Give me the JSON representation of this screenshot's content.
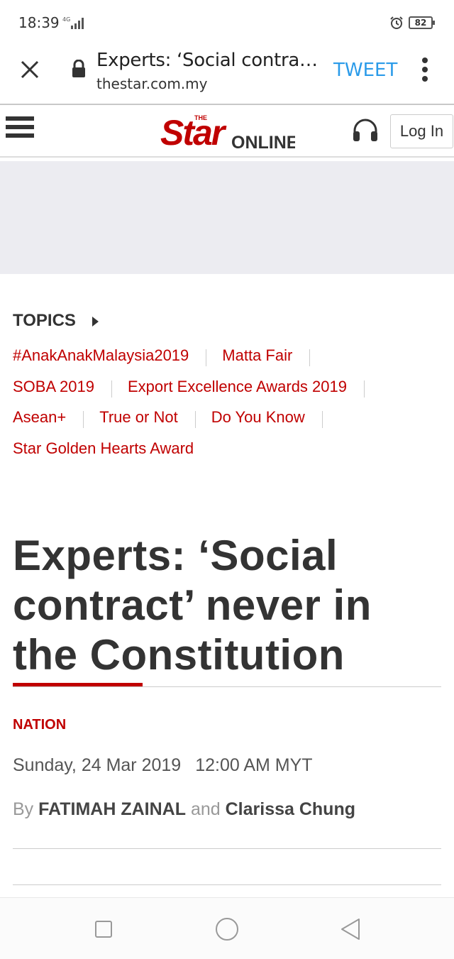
{
  "status_bar": {
    "time": "18:39",
    "network": "4G",
    "battery": "82"
  },
  "browser": {
    "title": "Experts: ‘Social contra…",
    "url": "thestar.com.my",
    "tweet_label": "TWEET"
  },
  "site_header": {
    "logo_the": "THE",
    "logo_star": "Star",
    "logo_online": "ONLINE",
    "login_label": "Log In"
  },
  "topics": {
    "heading": "TOPICS",
    "rows": [
      [
        "#AnakAnakMalaysia2019",
        "Matta Fair"
      ],
      [
        "SOBA 2019",
        "Export Excellence Awards 2019"
      ],
      [
        "Asean+",
        "True or Not",
        "Do You Know"
      ],
      [
        "Star Golden Hearts Award"
      ]
    ]
  },
  "article": {
    "title_lines": [
      "Experts: ‘Social",
      "contract’ never in",
      "the Constitution"
    ],
    "category": "NATION",
    "date": "Sunday, 24 Mar 2019",
    "time": "12:00 AM MYT",
    "by": "By",
    "author1": "FATIMAH ZAINAL",
    "and": "and",
    "author2": "Clarissa Chung"
  },
  "colors": {
    "accent": "#c00000",
    "tweet": "#2b9be9",
    "ad_bg": "#ececf1"
  }
}
